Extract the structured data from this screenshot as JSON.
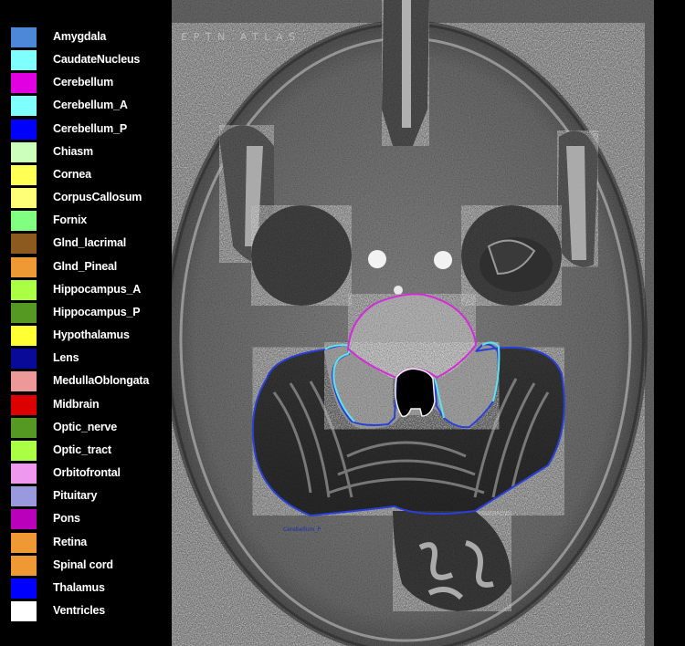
{
  "atlas_title": "EPTN ATLAS",
  "cursor_label": "Cerebellum_P",
  "legend": [
    {
      "label": "Amygdala",
      "color": "#4d88d8"
    },
    {
      "label": "CaudateNucleus",
      "color": "#80ffff"
    },
    {
      "label": "Cerebellum",
      "color": "#e100e1"
    },
    {
      "label": "Cerebellum_A",
      "color": "#80ffff"
    },
    {
      "label": "Cerebellum_P",
      "color": "#0000ff"
    },
    {
      "label": "Chiasm",
      "color": "#ccffbb"
    },
    {
      "label": "Cornea",
      "color": "#ffff55"
    },
    {
      "label": "CorpusCallosum",
      "color": "#ffff77"
    },
    {
      "label": "Fornix",
      "color": "#80ff80"
    },
    {
      "label": "Glnd_lacrimal",
      "color": "#8c5a1e"
    },
    {
      "label": "Glnd_Pineal",
      "color": "#ee9933"
    },
    {
      "label": "Hippocampus_A",
      "color": "#aaff44"
    },
    {
      "label": "Hippocampus_P",
      "color": "#559922"
    },
    {
      "label": "Hypothalamus",
      "color": "#ffff33"
    },
    {
      "label": "Lens",
      "color": "#0a0a99"
    },
    {
      "label": "MedullaOblongata",
      "color": "#ee9999"
    },
    {
      "label": "Midbrain",
      "color": "#dd0000"
    },
    {
      "label": "Optic_nerve",
      "color": "#559922"
    },
    {
      "label": "Optic_tract",
      "color": "#aaff44"
    },
    {
      "label": "Orbitofrontal",
      "color": "#ee99ee"
    },
    {
      "label": "Pituitary",
      "color": "#9999dd"
    },
    {
      "label": "Pons",
      "color": "#bb00bb"
    },
    {
      "label": "Retina",
      "color": "#ee9933"
    },
    {
      "label": "Spinal cord",
      "color": "#ee9933"
    },
    {
      "label": "Thalamus",
      "color": "#0000ff"
    },
    {
      "label": "Ventricles",
      "color": "#ffffff"
    }
  ]
}
